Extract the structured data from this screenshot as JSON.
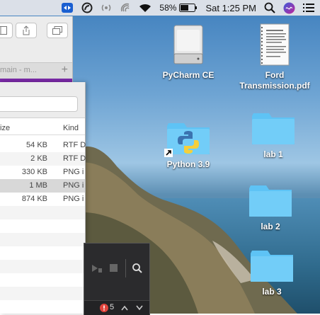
{
  "menubar": {
    "battery_percent": "58%",
    "clock": "Sat 1:25 PM",
    "icons": [
      "teamviewer-icon",
      "dropzone-icon",
      "radio-icon",
      "wireless-icon",
      "wifi-icon",
      "battery-icon",
      "search-icon",
      "siri-icon",
      "list-icon"
    ]
  },
  "finder_back": {
    "tab_label": "main - m...",
    "tab_plus": "+",
    "icons": [
      "sidebar-toggle-icon",
      "share-icon",
      "tabs-icon"
    ]
  },
  "finder_front": {
    "columns": {
      "size": "ize",
      "kind": "Kind"
    },
    "rows": [
      {
        "size": "54 KB",
        "kind": "RTF D"
      },
      {
        "size": "2 KB",
        "kind": "RTF D"
      },
      {
        "size": "330 KB",
        "kind": "PNG i"
      },
      {
        "size": "1 MB",
        "kind": "PNG i"
      },
      {
        "size": "874 KB",
        "kind": "PNG i"
      }
    ]
  },
  "ide_panel": {
    "error_count": "5"
  },
  "desktop": {
    "icons": [
      {
        "name": "pycharm",
        "label": "PyCharm CE",
        "type": "drive"
      },
      {
        "name": "ford",
        "label": "Ford Transmission.pdf",
        "type": "pdf"
      },
      {
        "name": "python",
        "label": "Python 3.9",
        "type": "python-folder"
      },
      {
        "name": "lab1",
        "label": "lab 1",
        "type": "folder"
      },
      {
        "name": "lab2",
        "label": "lab 2",
        "type": "folder"
      },
      {
        "name": "lab3",
        "label": "lab 3",
        "type": "folder"
      }
    ]
  },
  "colors": {
    "folder": "#5ec3f5",
    "selection_purple": "#7b2aa8",
    "error_red": "#e0443c"
  }
}
